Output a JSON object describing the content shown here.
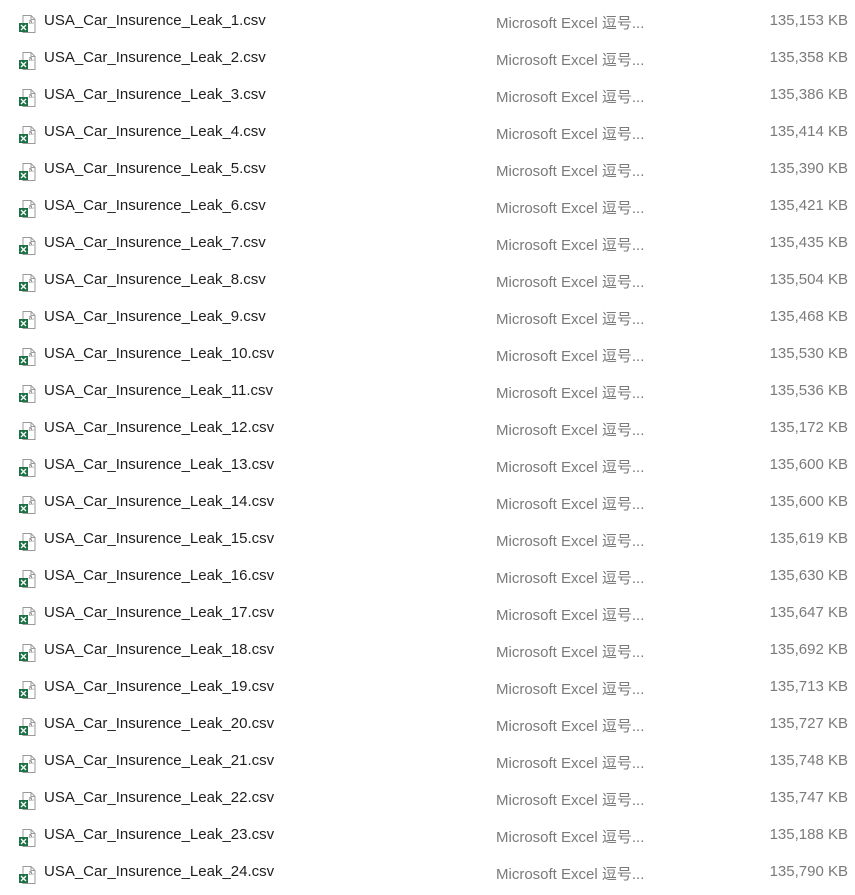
{
  "files": [
    {
      "name": "USA_Car_Insurence_Leak_1.csv",
      "type": "Microsoft Excel 逗号...",
      "size": "135,153 KB",
      "icon": "excel-csv-file-icon"
    },
    {
      "name": "USA_Car_Insurence_Leak_2.csv",
      "type": "Microsoft Excel 逗号...",
      "size": "135,358 KB",
      "icon": "excel-csv-file-icon"
    },
    {
      "name": "USA_Car_Insurence_Leak_3.csv",
      "type": "Microsoft Excel 逗号...",
      "size": "135,386 KB",
      "icon": "excel-csv-file-icon"
    },
    {
      "name": "USA_Car_Insurence_Leak_4.csv",
      "type": "Microsoft Excel 逗号...",
      "size": "135,414 KB",
      "icon": "excel-csv-file-icon"
    },
    {
      "name": "USA_Car_Insurence_Leak_5.csv",
      "type": "Microsoft Excel 逗号...",
      "size": "135,390 KB",
      "icon": "excel-csv-file-icon"
    },
    {
      "name": "USA_Car_Insurence_Leak_6.csv",
      "type": "Microsoft Excel 逗号...",
      "size": "135,421 KB",
      "icon": "excel-csv-file-icon"
    },
    {
      "name": "USA_Car_Insurence_Leak_7.csv",
      "type": "Microsoft Excel 逗号...",
      "size": "135,435 KB",
      "icon": "excel-csv-file-icon"
    },
    {
      "name": "USA_Car_Insurence_Leak_8.csv",
      "type": "Microsoft Excel 逗号...",
      "size": "135,504 KB",
      "icon": "excel-csv-file-icon"
    },
    {
      "name": "USA_Car_Insurence_Leak_9.csv",
      "type": "Microsoft Excel 逗号...",
      "size": "135,468 KB",
      "icon": "excel-csv-file-icon"
    },
    {
      "name": "USA_Car_Insurence_Leak_10.csv",
      "type": "Microsoft Excel 逗号...",
      "size": "135,530 KB",
      "icon": "excel-csv-file-icon"
    },
    {
      "name": "USA_Car_Insurence_Leak_11.csv",
      "type": "Microsoft Excel 逗号...",
      "size": "135,536 KB",
      "icon": "excel-csv-file-icon"
    },
    {
      "name": "USA_Car_Insurence_Leak_12.csv",
      "type": "Microsoft Excel 逗号...",
      "size": "135,172 KB",
      "icon": "excel-csv-file-icon"
    },
    {
      "name": "USA_Car_Insurence_Leak_13.csv",
      "type": "Microsoft Excel 逗号...",
      "size": "135,600 KB",
      "icon": "excel-csv-file-icon"
    },
    {
      "name": "USA_Car_Insurence_Leak_14.csv",
      "type": "Microsoft Excel 逗号...",
      "size": "135,600 KB",
      "icon": "excel-csv-file-icon"
    },
    {
      "name": "USA_Car_Insurence_Leak_15.csv",
      "type": "Microsoft Excel 逗号...",
      "size": "135,619 KB",
      "icon": "excel-csv-file-icon"
    },
    {
      "name": "USA_Car_Insurence_Leak_16.csv",
      "type": "Microsoft Excel 逗号...",
      "size": "135,630 KB",
      "icon": "excel-csv-file-icon"
    },
    {
      "name": "USA_Car_Insurence_Leak_17.csv",
      "type": "Microsoft Excel 逗号...",
      "size": "135,647 KB",
      "icon": "excel-csv-file-icon"
    },
    {
      "name": "USA_Car_Insurence_Leak_18.csv",
      "type": "Microsoft Excel 逗号...",
      "size": "135,692 KB",
      "icon": "excel-csv-file-icon"
    },
    {
      "name": "USA_Car_Insurence_Leak_19.csv",
      "type": "Microsoft Excel 逗号...",
      "size": "135,713 KB",
      "icon": "excel-csv-file-icon"
    },
    {
      "name": "USA_Car_Insurence_Leak_20.csv",
      "type": "Microsoft Excel 逗号...",
      "size": "135,727 KB",
      "icon": "excel-csv-file-icon"
    },
    {
      "name": "USA_Car_Insurence_Leak_21.csv",
      "type": "Microsoft Excel 逗号...",
      "size": "135,748 KB",
      "icon": "excel-csv-file-icon"
    },
    {
      "name": "USA_Car_Insurence_Leak_22.csv",
      "type": "Microsoft Excel 逗号...",
      "size": "135,747 KB",
      "icon": "excel-csv-file-icon"
    },
    {
      "name": "USA_Car_Insurence_Leak_23.csv",
      "type": "Microsoft Excel 逗号...",
      "size": "135,188 KB",
      "icon": "excel-csv-file-icon"
    },
    {
      "name": "USA_Car_Insurence_Leak_24.csv",
      "type": "Microsoft Excel 逗号...",
      "size": "135,790 KB",
      "icon": "excel-csv-file-icon"
    }
  ],
  "colors": {
    "excel_green": "#1d7044",
    "name_text": "#1e1e1e",
    "meta_text": "#7a7a7a"
  }
}
